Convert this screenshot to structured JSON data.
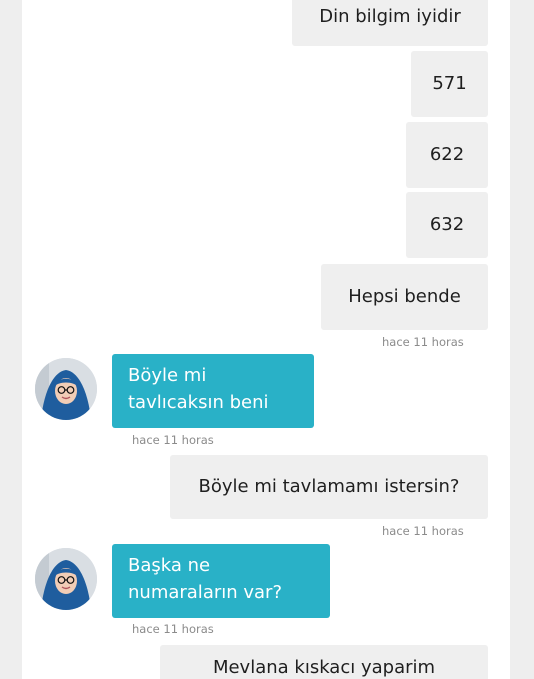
{
  "messages": [
    {
      "text": "Din bilgim iyidir",
      "side": "out"
    },
    {
      "text": "571",
      "side": "out"
    },
    {
      "text": "622",
      "side": "out"
    },
    {
      "text": "632",
      "side": "out"
    },
    {
      "text": "Hepsi bende",
      "side": "out"
    },
    {
      "text": "Böyle mi tavlıcaksın beni",
      "side": "in"
    },
    {
      "text": "Böyle mi tavlamamı istersin?",
      "side": "out"
    },
    {
      "text": "Başka ne numaraların var?",
      "side": "in"
    },
    {
      "text": "Mevlana kıskacı yaparim",
      "side": "out"
    }
  ],
  "timestamps": [
    "hace 11 horas",
    "hace 11 horas",
    "hace 11 horas",
    "hace 11 horas"
  ],
  "colors": {
    "incoming_bubble": "#29b1c7",
    "outgoing_bubble": "#efefef",
    "hijab": "#1f5d9e"
  },
  "icons": [
    "user-avatar"
  ]
}
